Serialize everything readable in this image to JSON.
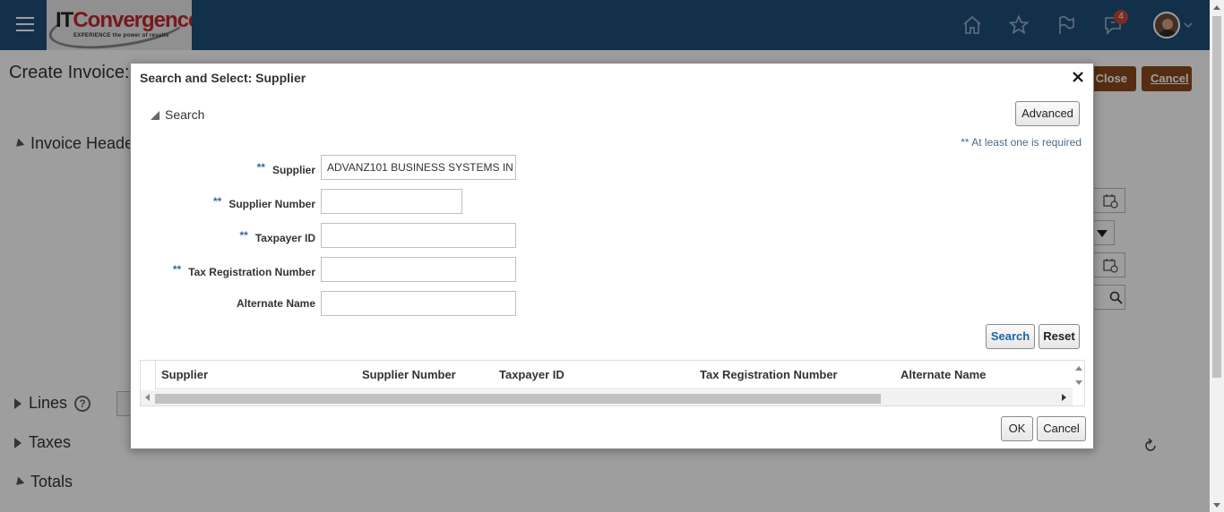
{
  "header": {
    "logo_brand_prefix": "IT",
    "logo_brand_suffix": "Convergence",
    "logo_tagline": "EXPERIENCE the power of results",
    "notification_count": "4",
    "icons": [
      "menu-icon",
      "home-icon",
      "star-icon",
      "flag-icon",
      "bell-icon",
      "avatar",
      "chevron-down-icon"
    ]
  },
  "page": {
    "title": "Create Invoice:",
    "close_button": "Close",
    "cancel_button": "Cancel",
    "sections": {
      "invoice_header": "Invoice Heade",
      "lines": "Lines",
      "taxes": "Taxes",
      "totals": "Totals"
    }
  },
  "dialog": {
    "title": "Search and Select: Supplier",
    "search_label": "Search",
    "advanced_button": "Advanced",
    "required_note": "** At least one is required",
    "fields": {
      "supplier": {
        "label": "Supplier",
        "stars": "**",
        "value": "ADVANZ101 BUSINESS SYSTEMS IN"
      },
      "supplier_number": {
        "label": "Supplier Number",
        "stars": "**",
        "value": ""
      },
      "taxpayer_id": {
        "label": "Taxpayer ID",
        "stars": "**",
        "value": ""
      },
      "tax_registration_number": {
        "label": "Tax Registration Number",
        "stars": "**",
        "value": ""
      },
      "alternate_name": {
        "label": "Alternate Name",
        "value": ""
      }
    },
    "search_button": "Search",
    "reset_button": "Reset",
    "table": {
      "columns": [
        "Supplier",
        "Supplier Number",
        "Taxpayer ID",
        "Tax Registration Number",
        "Alternate Name"
      ]
    },
    "ok_button": "OK",
    "cancel_button": "Cancel"
  },
  "colors": {
    "header_bg": "#1f4e79",
    "brand_red": "#c0272d",
    "action_button": "#8b4a1e",
    "badge": "#c74634",
    "link_blue": "#1e64a8"
  }
}
